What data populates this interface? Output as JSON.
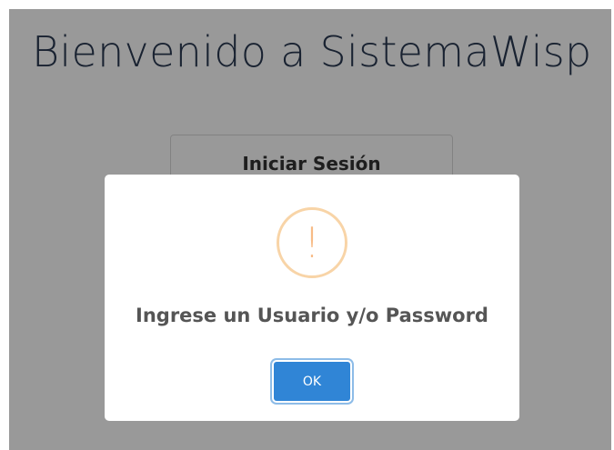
{
  "page": {
    "title": "Bienvenido a SistemaWisp"
  },
  "login": {
    "title": "Iniciar Sesión"
  },
  "alert": {
    "icon": "warning-icon",
    "icon_glyph": "!",
    "message": "Ingrese un Usuario y/o Password",
    "confirm_label": "OK"
  },
  "colors": {
    "confirm_button": "#3085d6",
    "warning_ring": "#f8d4a7",
    "warning_glyph": "#f8bb86",
    "title_text": "#2a3a52",
    "message_text": "#555555"
  }
}
